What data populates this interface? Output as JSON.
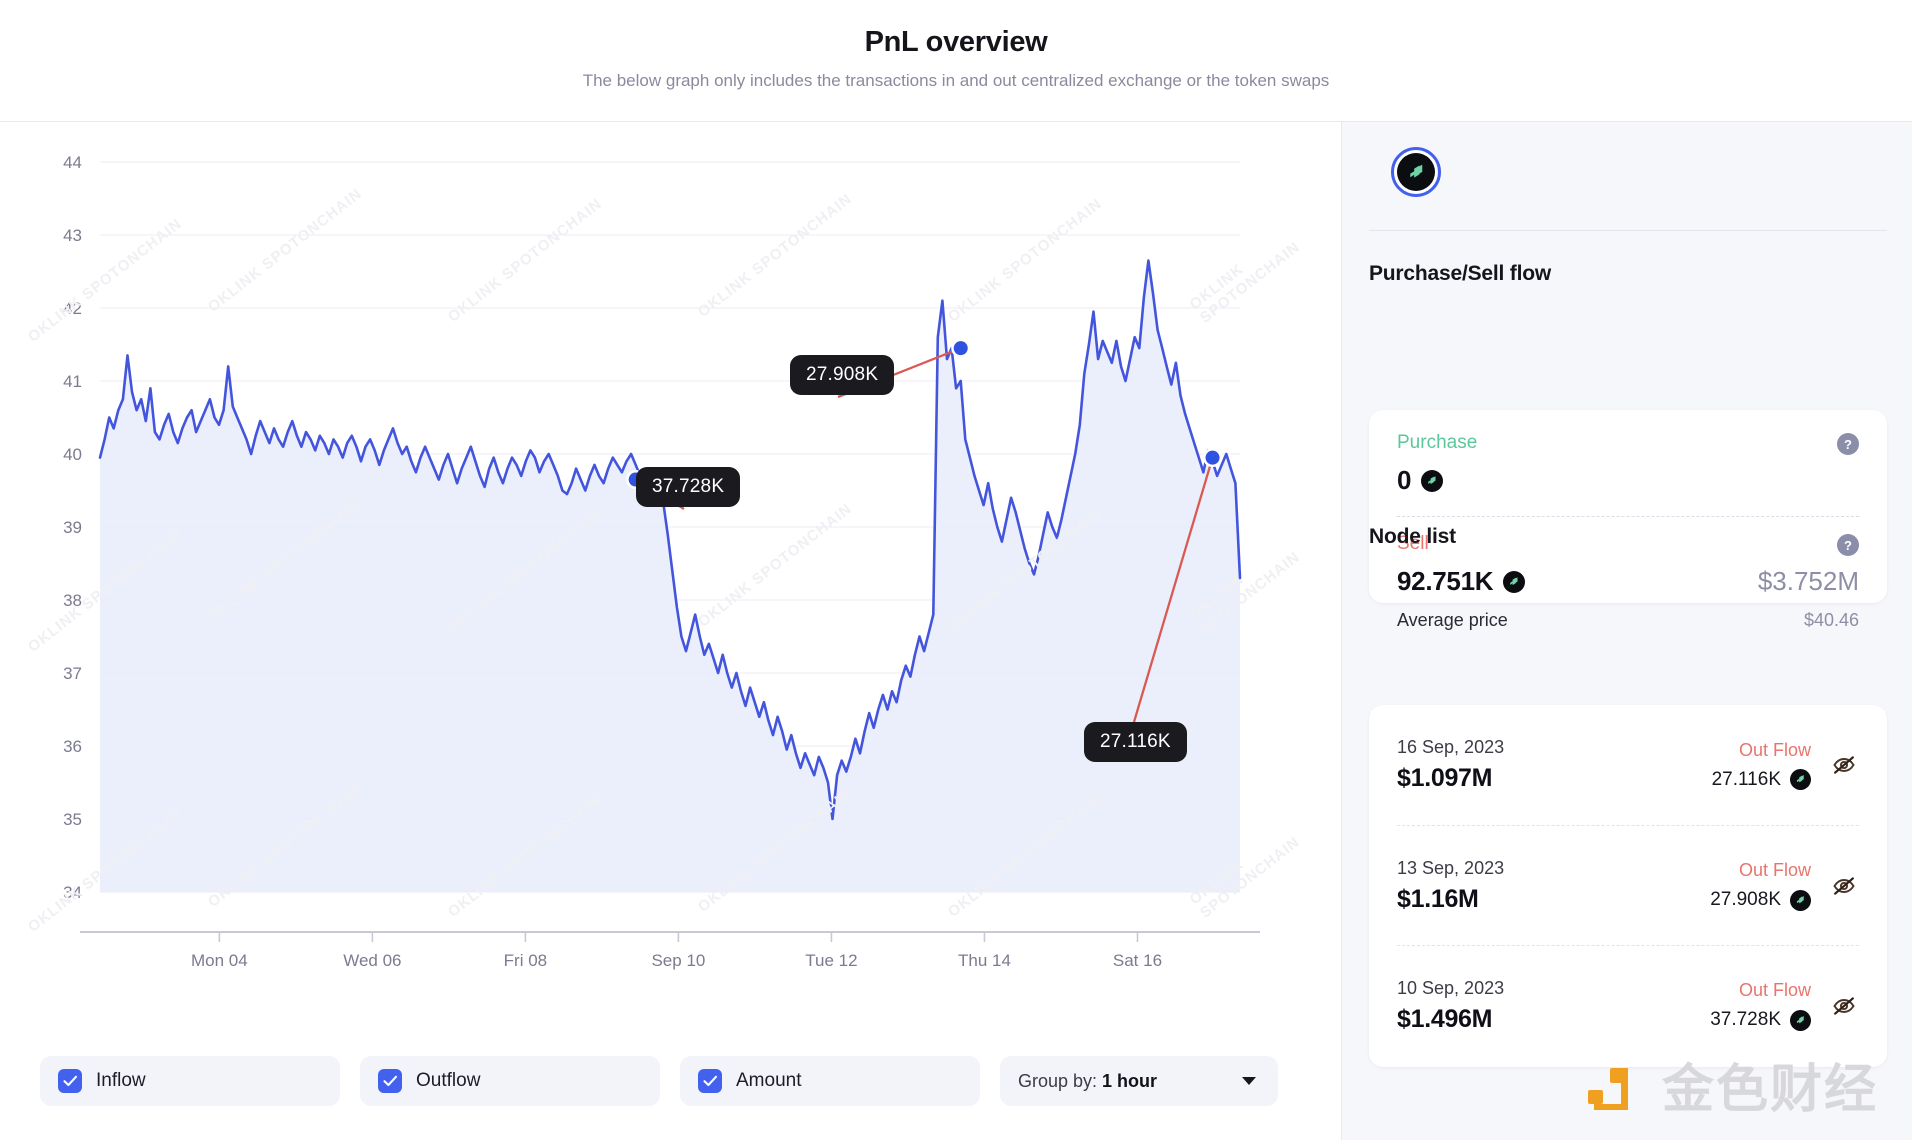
{
  "header": {
    "title": "PnL overview",
    "subtitle": "The below graph only includes the transactions in and out centralized exchange or the token swaps"
  },
  "chart_data": {
    "type": "line",
    "title": "PnL overview",
    "xlabel": "",
    "ylabel": "",
    "ylim": [
      34,
      44
    ],
    "yticks": [
      34,
      35,
      36,
      37,
      38,
      39,
      40,
      41,
      42,
      43,
      44
    ],
    "xtick_labels": [
      "Mon 04",
      "Wed 06",
      "Fri 08",
      "Sep 10",
      "Tue 12",
      "Thu 14",
      "Sat 16"
    ],
    "grid": true,
    "legend_position": "none",
    "series": [
      {
        "name": "Amount",
        "color": "#4455dd",
        "fill": "#e8ecfb",
        "values": [
          39.95,
          40.2,
          40.5,
          40.35,
          40.6,
          40.75,
          41.35,
          40.85,
          40.6,
          40.75,
          40.45,
          40.9,
          40.3,
          40.2,
          40.4,
          40.55,
          40.3,
          40.15,
          40.35,
          40.5,
          40.6,
          40.3,
          40.45,
          40.6,
          40.75,
          40.5,
          40.4,
          40.6,
          41.2,
          40.65,
          40.5,
          40.35,
          40.2,
          40.0,
          40.25,
          40.45,
          40.3,
          40.15,
          40.35,
          40.2,
          40.1,
          40.3,
          40.45,
          40.25,
          40.1,
          40.3,
          40.2,
          40.05,
          40.25,
          40.15,
          40.0,
          40.2,
          40.1,
          39.95,
          40.15,
          40.25,
          40.1,
          39.9,
          40.1,
          40.2,
          40.05,
          39.85,
          40.05,
          40.2,
          40.35,
          40.15,
          40.0,
          40.1,
          39.9,
          39.75,
          39.95,
          40.1,
          39.95,
          39.8,
          39.65,
          39.85,
          40.0,
          39.8,
          39.6,
          39.8,
          39.95,
          40.1,
          39.9,
          39.7,
          39.55,
          39.8,
          39.95,
          39.75,
          39.6,
          39.8,
          39.95,
          39.85,
          39.7,
          39.9,
          40.05,
          39.95,
          39.75,
          39.9,
          40.0,
          39.85,
          39.7,
          39.5,
          39.45,
          39.6,
          39.8,
          39.65,
          39.5,
          39.7,
          39.85,
          39.7,
          39.6,
          39.8,
          39.95,
          39.85,
          39.75,
          39.9,
          40.0,
          39.85,
          39.7,
          39.65,
          39.75,
          39.6,
          39.5,
          39.35,
          38.9,
          38.4,
          37.9,
          37.5,
          37.3,
          37.55,
          37.8,
          37.5,
          37.25,
          37.4,
          37.2,
          37.0,
          37.25,
          37.0,
          36.8,
          37.0,
          36.75,
          36.55,
          36.8,
          36.6,
          36.4,
          36.6,
          36.35,
          36.15,
          36.4,
          36.2,
          35.95,
          36.15,
          35.9,
          35.7,
          35.9,
          35.75,
          35.6,
          35.85,
          35.7,
          35.5,
          35.0,
          35.6,
          35.8,
          35.65,
          35.85,
          36.1,
          35.9,
          36.2,
          36.45,
          36.25,
          36.5,
          36.7,
          36.5,
          36.75,
          36.6,
          36.9,
          37.1,
          36.95,
          37.25,
          37.5,
          37.3,
          37.55,
          37.8,
          41.6,
          42.1,
          41.3,
          41.45,
          40.9,
          41.0,
          40.2,
          39.95,
          39.7,
          39.5,
          39.3,
          39.6,
          39.25,
          39.0,
          38.8,
          39.1,
          39.4,
          39.2,
          38.95,
          38.7,
          38.5,
          38.35,
          38.6,
          38.9,
          39.2,
          39.0,
          38.85,
          39.1,
          39.4,
          39.7,
          40.0,
          40.4,
          41.1,
          41.5,
          41.95,
          41.3,
          41.55,
          41.4,
          41.25,
          41.55,
          41.2,
          41.0,
          41.3,
          41.6,
          41.45,
          42.15,
          42.65,
          42.2,
          41.7,
          41.45,
          41.2,
          40.95,
          41.25,
          40.8,
          40.55,
          40.35,
          40.15,
          39.95,
          39.75,
          40.05,
          39.9,
          39.7,
          39.85,
          40.0,
          39.8,
          39.6,
          38.3
        ]
      }
    ],
    "annotations": [
      {
        "label": "37.728K",
        "value_at_point": 39.65,
        "point_index": 117
      },
      {
        "label": "27.908K",
        "value_at_point": 41.45,
        "point_index": 188
      },
      {
        "label": "27.116K",
        "value_at_point": 39.95,
        "point_index": 243
      }
    ],
    "watermark_text": "OKLINK SPOTONCHAIN"
  },
  "controls": {
    "inflow_label": "Inflow",
    "outflow_label": "Outflow",
    "amount_label": "Amount",
    "group_by_prefix": "Group by: ",
    "group_by_value": "1 hour",
    "inflow_checked": true,
    "outflow_checked": true,
    "amount_checked": true
  },
  "sidebar": {
    "token_symbol": "COMP",
    "flow_heading": "Purchase/Sell flow",
    "purchase": {
      "label": "Purchase",
      "amount": "0",
      "usd": "",
      "help": "?"
    },
    "sell": {
      "label": "Sell",
      "amount": "92.751K",
      "usd": "$3.752M",
      "avg_label": "Average price",
      "avg_value": "$40.46",
      "help": "?"
    },
    "node_heading": "Node list",
    "nodes": [
      {
        "date": "16 Sep, 2023",
        "usd": "$1.097M",
        "flow": "Out Flow",
        "amount": "27.116K"
      },
      {
        "date": "13 Sep, 2023",
        "usd": "$1.16M",
        "flow": "Out Flow",
        "amount": "27.908K"
      },
      {
        "date": "10 Sep, 2023",
        "usd": "$1.496M",
        "flow": "Out Flow",
        "amount": "37.728K"
      }
    ]
  },
  "brand": {
    "name": "金色财经"
  },
  "colors": {
    "line": "#4455dd",
    "area": "#e8ecfb",
    "accent": "#4361ee",
    "sell": "#e8756c",
    "purchase": "#5cc79b",
    "tooltip_bg": "#1b1b1f",
    "annotation_line": "#d85a52",
    "brand": "#f0a021"
  }
}
